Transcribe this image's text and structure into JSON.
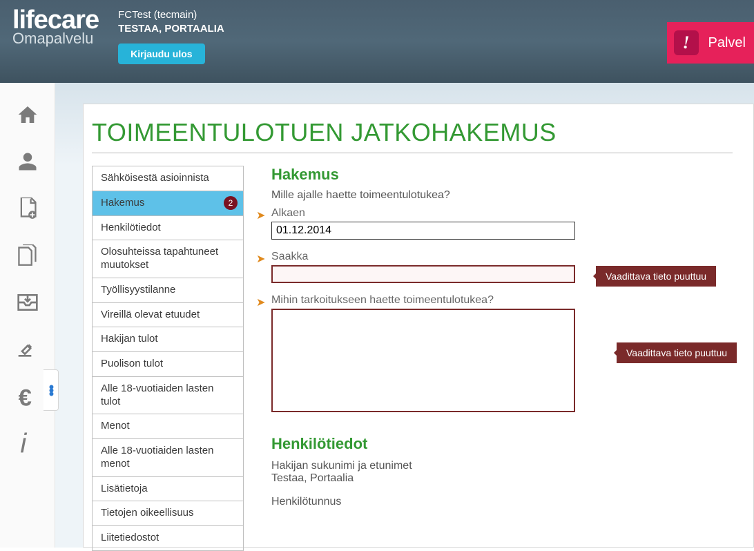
{
  "header": {
    "logo_main": "lifecare",
    "logo_sub": "Omapalvelu",
    "user_context": "FCTest (tecmain)",
    "user_name": "TESTAA, PORTAALIA",
    "logout_label": "Kirjaudu ulos",
    "alert_label": "Palvel"
  },
  "page": {
    "title": "TOIMEENTULOTUEN JATKOHAKEMUS"
  },
  "nav": {
    "items": [
      {
        "label": "Sähköisestä asioinnista"
      },
      {
        "label": "Hakemus",
        "active": true,
        "badge": "2"
      },
      {
        "label": "Henkilötiedot"
      },
      {
        "label": "Olosuhteissa tapahtuneet muutokset"
      },
      {
        "label": "Työllisyystilanne"
      },
      {
        "label": "Vireillä olevat etuudet"
      },
      {
        "label": "Hakijan tulot"
      },
      {
        "label": "Puolison tulot"
      },
      {
        "label": "Alle 18-vuotiaiden lasten tulot"
      },
      {
        "label": "Menot"
      },
      {
        "label": "Alle 18-vuotiaiden lasten menot"
      },
      {
        "label": "Lisätietoja"
      },
      {
        "label": "Tietojen oikeellisuus"
      },
      {
        "label": "Liitetiedostot"
      }
    ]
  },
  "form": {
    "section1": "Hakemus",
    "question1": "Mille ajalle haette toimeentulotukea?",
    "from_label": "Alkaen",
    "from_value": "01.12.2014",
    "to_label": "Saakka",
    "to_value": "",
    "purpose_label": "Mihin tarkoitukseen haette toimeentulotukea?",
    "purpose_value": "",
    "error_msg": "Vaadittava tieto puuttuu",
    "section2": "Henkilötiedot",
    "name_label": "Hakijan sukunimi ja etunimet",
    "name_value": "Testaa, Portaalia",
    "ssn_label": "Henkilötunnus"
  }
}
